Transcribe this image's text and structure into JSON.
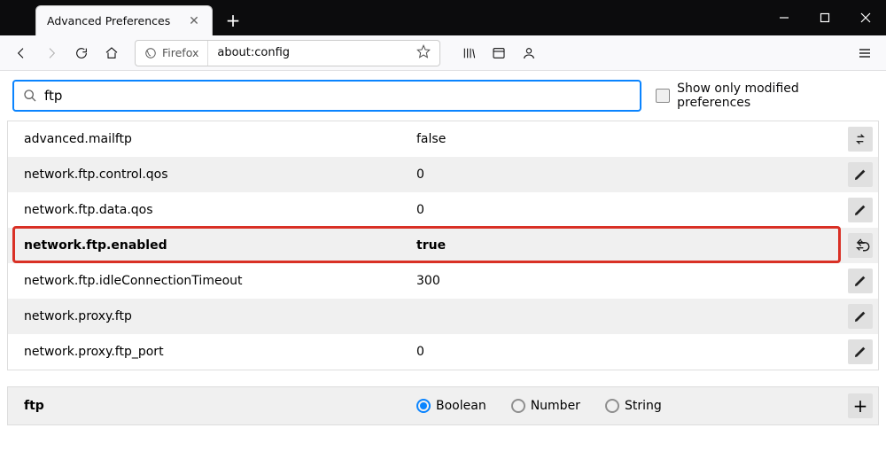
{
  "window": {
    "tab_title": "Advanced Preferences"
  },
  "urlbar": {
    "identity_label": "Firefox",
    "url": "about:config"
  },
  "search": {
    "value": "ftp",
    "show_modified_label": "Show only modified preferences"
  },
  "prefs": {
    "rows": [
      {
        "name": "advanced.mailftp",
        "value": "false",
        "action": "toggle"
      },
      {
        "name": "network.ftp.control.qos",
        "value": "0",
        "action": "edit"
      },
      {
        "name": "network.ftp.data.qos",
        "value": "0",
        "action": "edit"
      },
      {
        "name": "network.ftp.enabled",
        "value": "true",
        "action": "toggle",
        "highlighted": true
      },
      {
        "name": "network.ftp.idleConnectionTimeout",
        "value": "300",
        "action": "edit"
      },
      {
        "name": "network.proxy.ftp",
        "value": "",
        "action": "edit"
      },
      {
        "name": "network.proxy.ftp_port",
        "value": "0",
        "action": "edit"
      }
    ]
  },
  "newpref": {
    "name": "ftp",
    "types": {
      "boolean": "Boolean",
      "number": "Number",
      "string": "String"
    },
    "selected": "boolean"
  }
}
